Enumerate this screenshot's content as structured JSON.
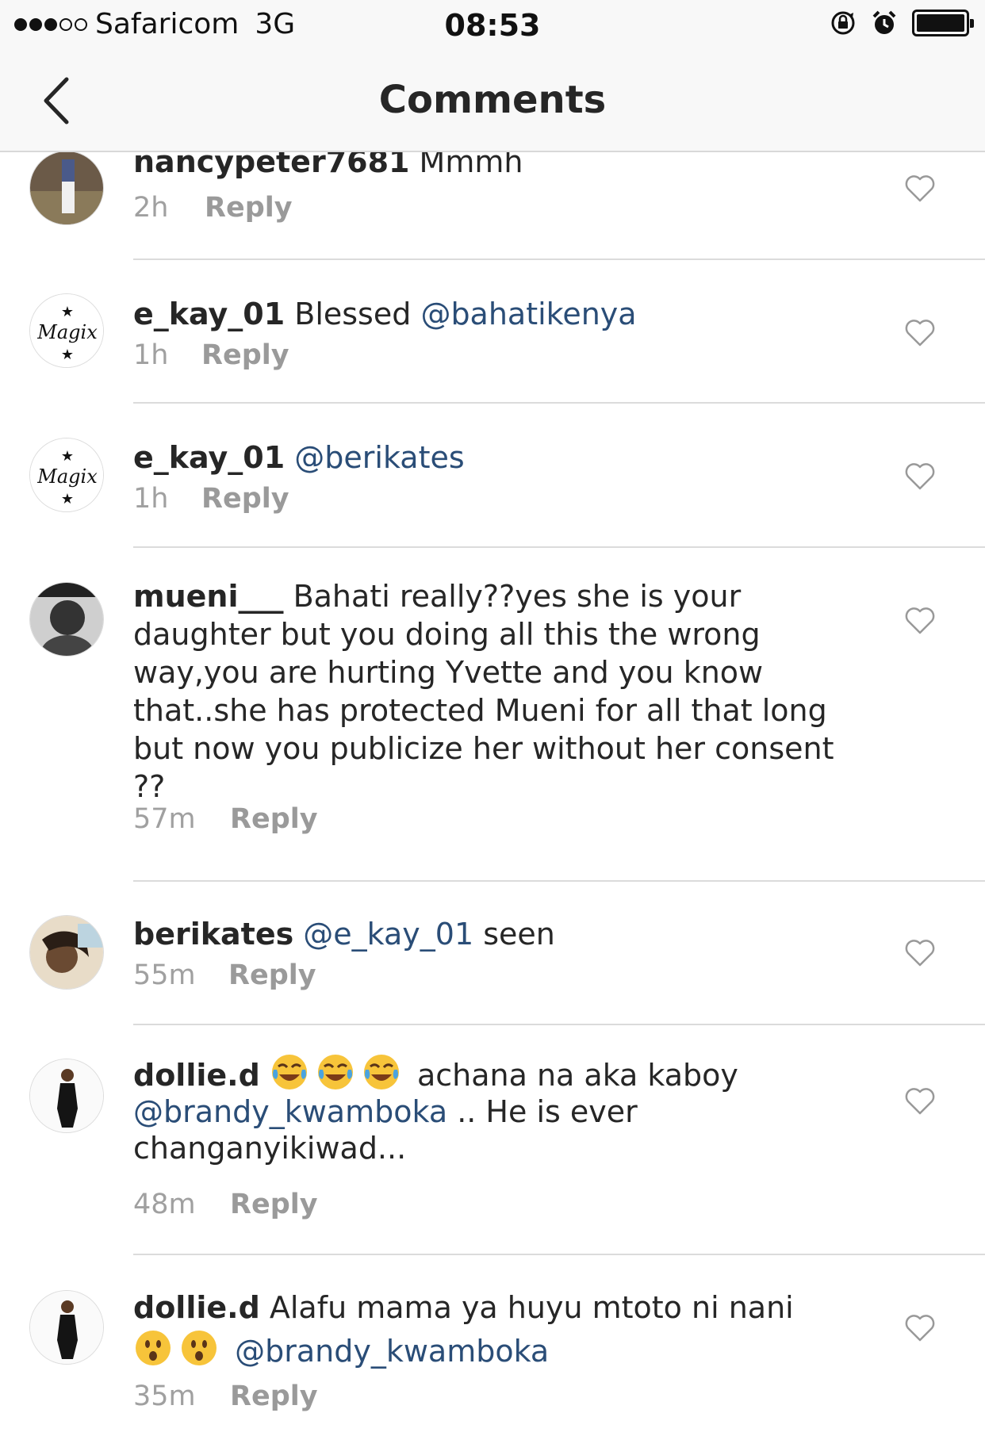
{
  "status_bar": {
    "carrier": "Safaricom",
    "network": "3G",
    "time": "08:53"
  },
  "nav": {
    "title": "Comments"
  },
  "comments": [
    {
      "user": "nancypeter7681",
      "text": " Mmmh",
      "time": "2h",
      "reply": "Reply"
    },
    {
      "user": "e_kay_01",
      "text": " Blessed ",
      "mention": "@bahatikenya",
      "time": "1h",
      "reply": "Reply"
    },
    {
      "user": "e_kay_01",
      "text": " ",
      "mention": "@berikates",
      "time": "1h",
      "reply": "Reply"
    },
    {
      "user": "mueni___",
      "text": " Bahati really??yes she is your daughter but you doing all this the wrong way,you are hurting Yvette and you know that..she has protected Mueni for all that long but now you publicize her without her consent ??",
      "time": "57m",
      "reply": "Reply"
    },
    {
      "user": "berikates",
      "mention": " @e_kay_01",
      "text": " seen",
      "time": "55m",
      "reply": "Reply"
    },
    {
      "user": "dollie.d",
      "text_after_emoji": " achana na aka kaboy",
      "mention": "@brandy_kwamboka",
      "text": " .. He is ever changanyikiwad...",
      "time": "48m",
      "reply": "Reply"
    },
    {
      "user": "dollie.d",
      "text": " Alafu mama ya huyu mtoto ni nani",
      "mention": "@brandy_kwamboka",
      "time": "35m",
      "reply": "Reply"
    }
  ],
  "icons": {
    "back": "chevron-left-icon",
    "like": "heart-outline-icon",
    "lock_rotation": "rotation-lock-icon",
    "alarm": "alarm-icon",
    "battery": "battery-icon",
    "emoji_laugh": "tears-of-joy-emoji",
    "emoji_surprised": "astonished-face-emoji"
  },
  "colors": {
    "mention": "#2a4d77",
    "meta": "#a0a0a0",
    "divider": "#dbdbdb"
  }
}
